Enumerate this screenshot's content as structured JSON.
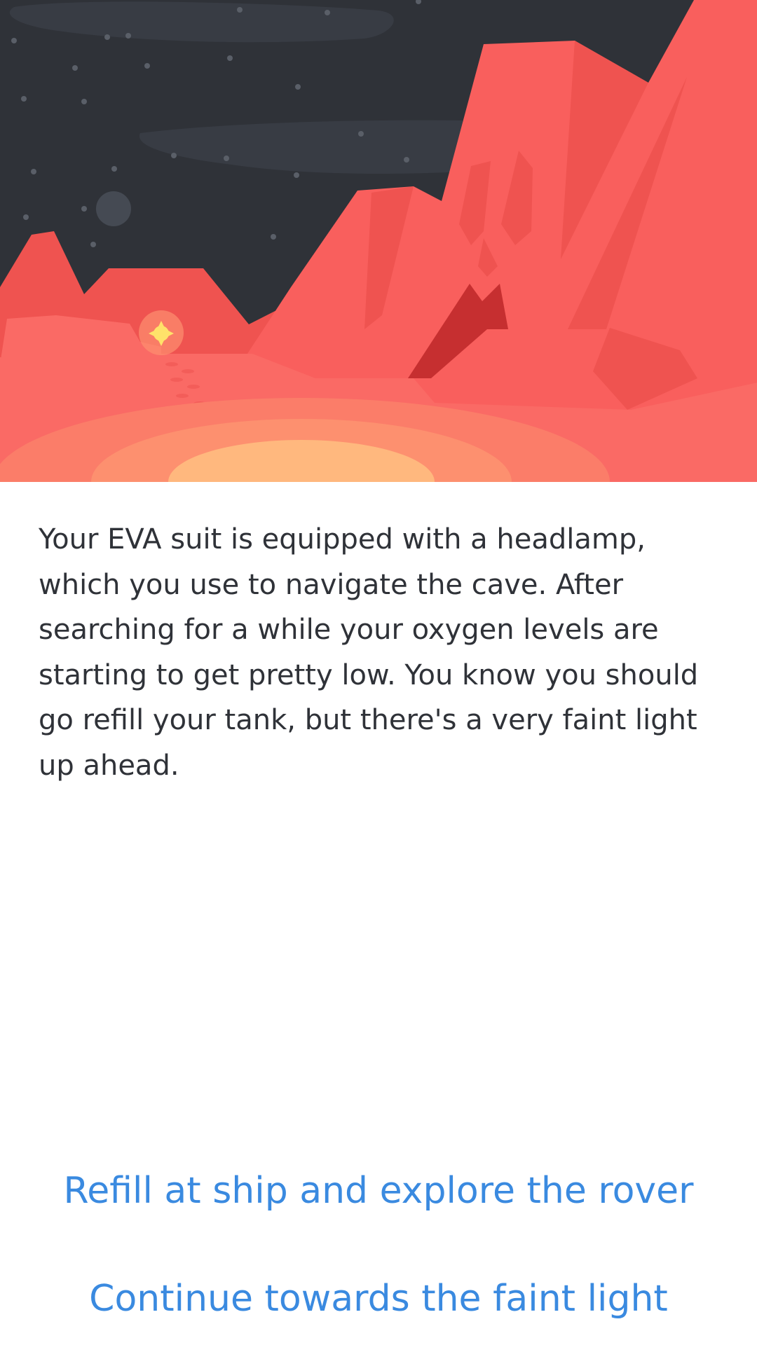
{
  "scene": {
    "colors": {
      "sky": "#2f3238",
      "cloud": "#383c44",
      "star": "#5a5f68",
      "moon": "#454a53",
      "cliff": "#f95f5d",
      "cliff_shadow": "#ef5350",
      "cave_dark": "#c62f30",
      "ground": "#fa6a65",
      "glow_outer": "#fb7d69",
      "glow_mid": "#fd906f",
      "glow_inner": "#ffb87e",
      "sun": "#ffe26a"
    }
  },
  "story": {
    "text": "Your EVA suit is equipped with a headlamp, which you use to navigate the cave. After searching for a while your oxygen levels are starting to get pretty low. You know you should go refill your tank, but there's a very faint light up ahead."
  },
  "choices": [
    {
      "label": "Refill at ship and explore the rover"
    },
    {
      "label": "Continue towards the faint light"
    }
  ],
  "theme": {
    "link_color": "#3a8ae0",
    "text_color": "#2f3238"
  }
}
